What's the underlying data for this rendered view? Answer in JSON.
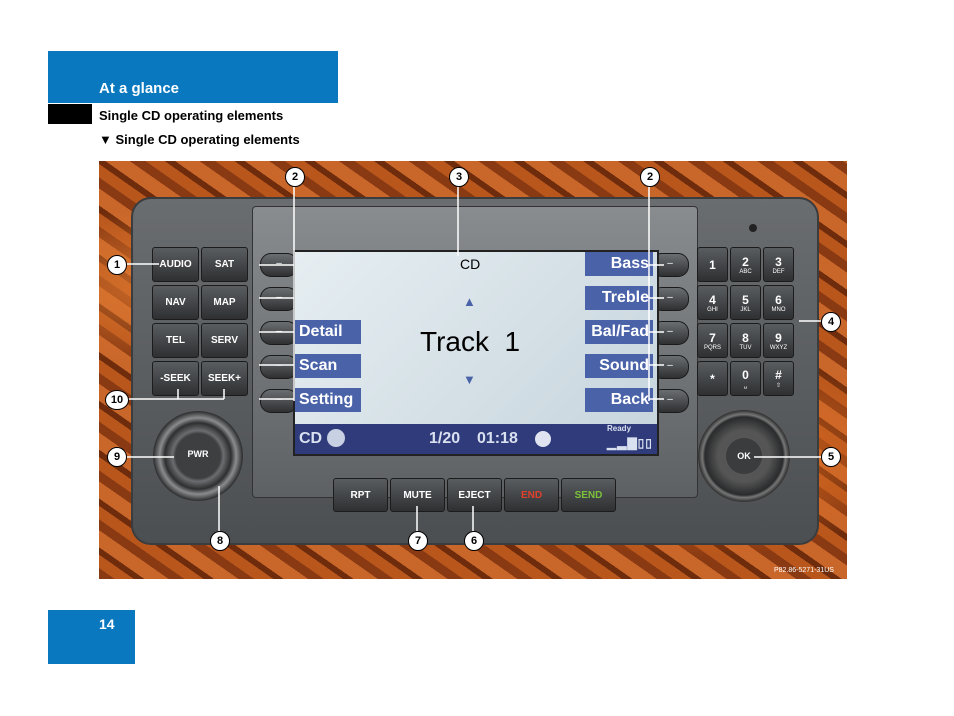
{
  "header": {
    "title": "At a glance",
    "subtitle": "Single CD operating elements"
  },
  "section_heading": "▼ Single CD operating elements",
  "page_number": "14",
  "figure": {
    "code": "P82.86-5271-31US",
    "left_buttons": [
      "AUDIO",
      "SAT",
      "NAV",
      "MAP",
      "TEL",
      "SERV",
      "-SEEK",
      "SEEK+"
    ],
    "soft_key_glyph": "–",
    "left_labels": [
      "Detail",
      "Scan",
      "Setting"
    ],
    "right_labels": [
      "Bass",
      "Treble",
      "Bal/Fad",
      "Sound",
      "Back"
    ],
    "screen": {
      "mode": "CD",
      "track": "Track  1",
      "status_mode": "CD",
      "position": "1/20",
      "time": "01:18",
      "ready": "Ready",
      "up_arrow": "▲",
      "down_arrow": "▼"
    },
    "keypad": [
      {
        "k": "1",
        "s": ""
      },
      {
        "k": "2",
        "s": "ABC"
      },
      {
        "k": "3",
        "s": "DEF"
      },
      {
        "k": "4",
        "s": "GHI"
      },
      {
        "k": "5",
        "s": "JKL"
      },
      {
        "k": "6",
        "s": "MNO"
      },
      {
        "k": "7",
        "s": "PQRS"
      },
      {
        "k": "8",
        "s": "TUV"
      },
      {
        "k": "9",
        "s": "WXYZ"
      },
      {
        "k": "*",
        "s": ""
      },
      {
        "k": "0",
        "s": "␣"
      },
      {
        "k": "#",
        "s": "⇧"
      }
    ],
    "bottom_buttons": [
      {
        "t": "RPT",
        "c": "#ffffff"
      },
      {
        "t": "MUTE",
        "c": "#ffffff"
      },
      {
        "t": "EJECT",
        "c": "#ffffff"
      },
      {
        "t": "END",
        "c": "#e0402a"
      },
      {
        "t": "SEND",
        "c": "#7bc23a"
      }
    ],
    "pwr": "PWR",
    "ok": "OK",
    "callouts": [
      "1",
      "2",
      "3",
      "2",
      "4",
      "5",
      "6",
      "7",
      "8",
      "9",
      "10"
    ]
  }
}
